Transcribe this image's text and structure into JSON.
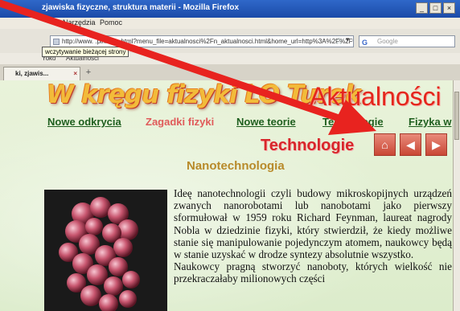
{
  "window": {
    "title": "zjawiska fizyczne, struktura materii - Mozilla Firefox",
    "buttons": [
      "_",
      "□",
      "×"
    ]
  },
  "menu": {
    "items": [
      "Narzędzia",
      "Pomoc"
    ]
  },
  "toolbar": {
    "url": "http://www.      .pl/index.html?menu_file=aktualnosci%2Fn_aktualnosci.html&home_url=http%3A%2F%2Fww",
    "search_placeholder": "Google",
    "search_engine_icon": "google-icon",
    "tooltip": "wczytywanie bieżącej strony",
    "star_glyph": "☆",
    "dropdown_glyph": "▾"
  },
  "bookmarks": {
    "items": [
      "Yoko",
      "Aktualności"
    ]
  },
  "tabs": [
    {
      "label": "ki, zjawis...",
      "close": "×"
    }
  ],
  "newtab_glyph": "+",
  "page": {
    "site_title": "W kręgu fizyki LO Turek",
    "section_title": "Aktualności",
    "nav": [
      {
        "label": "Nowe odkrycia"
      },
      {
        "label": "Zagadki fizyki"
      },
      {
        "label": "Nowe teorie"
      },
      {
        "label": "Technologie"
      },
      {
        "label": "Fizyka w"
      }
    ],
    "subheader": "Technologie",
    "nav_buttons": {
      "home": "⌂",
      "prev": "◀",
      "next": "▶"
    },
    "article_title": "Nanotechnologia",
    "article_paragraphs": [
      "Ideę nanotechnologii czyli budowy mikroskopijnych urządzeń zwanych nanorobotami lub nanobotami jako pierwszy sformułował w 1959 roku Richard Feynman, laureat nagrody Nobla w dziedzinie fizyki, który stwierdził, że kiedy możliwe stanie się manipulowanie pojedynczym atomem, naukowcy będą w stanie uzyskać w drodze syntezy absolutnie wszystko.",
      "Naukowcy pragną stworzyć nanoboty, których wielkość nie przekraczałaby milionowych części"
    ]
  },
  "colors": {
    "arrow": "#e8231f",
    "section_red": "#e4261c",
    "nav_green": "#1f5f1f",
    "nav_active": "#e05a5a",
    "article_title": "#b88a2a",
    "site_title": "#f2bb3a"
  }
}
